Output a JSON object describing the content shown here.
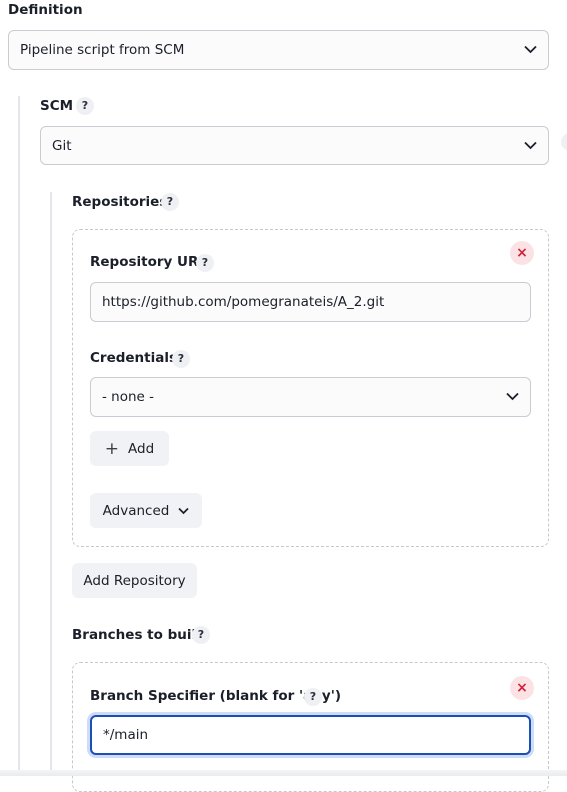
{
  "definition": {
    "label": "Definition",
    "selected": "Pipeline script from SCM"
  },
  "scm": {
    "label": "SCM",
    "help": "?",
    "selected": "Git"
  },
  "repositories": {
    "label": "Repositories",
    "help": "?",
    "repository_url_label": "Repository URL",
    "repository_url_value": "https://github.com/pomegranateis/A_2.git",
    "credentials_label": "Credentials",
    "credentials_selected": "- none -",
    "add_label": "Add",
    "add_symbol": "+",
    "advanced_label": "Advanced",
    "add_repository_label": "Add Repository",
    "close_symbol": "×"
  },
  "branches": {
    "label": "Branches to build",
    "help": "?",
    "specifier_label": "Branch Specifier (blank for 'any')",
    "specifier_value": "*/main"
  },
  "colors": {
    "focus": "#1a4fb8",
    "danger": "#d0223a",
    "border": "#c9ccd3"
  }
}
